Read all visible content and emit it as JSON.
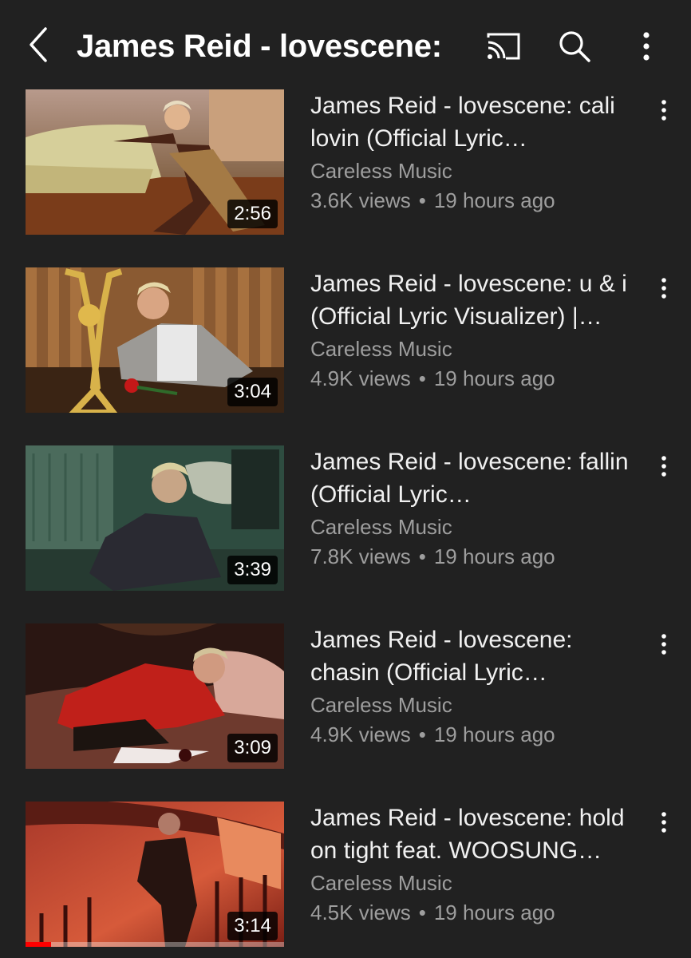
{
  "header": {
    "title": "James Reid - lovescene:",
    "back_icon": "chevron-left-icon",
    "cast_icon": "cast-icon",
    "search_icon": "search-icon",
    "more_icon": "more-vert-icon"
  },
  "videos": [
    {
      "title": "James Reid - lovescene: cali lovin (Official Lyric…",
      "channel": "Careless Music",
      "views": "3.6K views",
      "age": "19 hours ago",
      "duration": "2:56"
    },
    {
      "title": "James Reid - lovescene: u & i (Official Lyric Visualizer) |…",
      "channel": "Careless Music",
      "views": "4.9K views",
      "age": "19 hours ago",
      "duration": "3:04"
    },
    {
      "title": "James Reid - lovescene: fallin (Official Lyric…",
      "channel": "Careless Music",
      "views": "7.8K views",
      "age": "19 hours ago",
      "duration": "3:39"
    },
    {
      "title": "James Reid - lovescene: chasin (Official Lyric…",
      "channel": "Careless Music",
      "views": "4.9K views",
      "age": "19 hours ago",
      "duration": "3:09"
    },
    {
      "title": "James Reid - lovescene: hold on tight feat. WOOSUNG…",
      "channel": "Careless Music",
      "views": "4.5K views",
      "age": "19 hours ago",
      "duration": "3:14",
      "watched_fraction": 0.1
    }
  ],
  "separator": "•"
}
